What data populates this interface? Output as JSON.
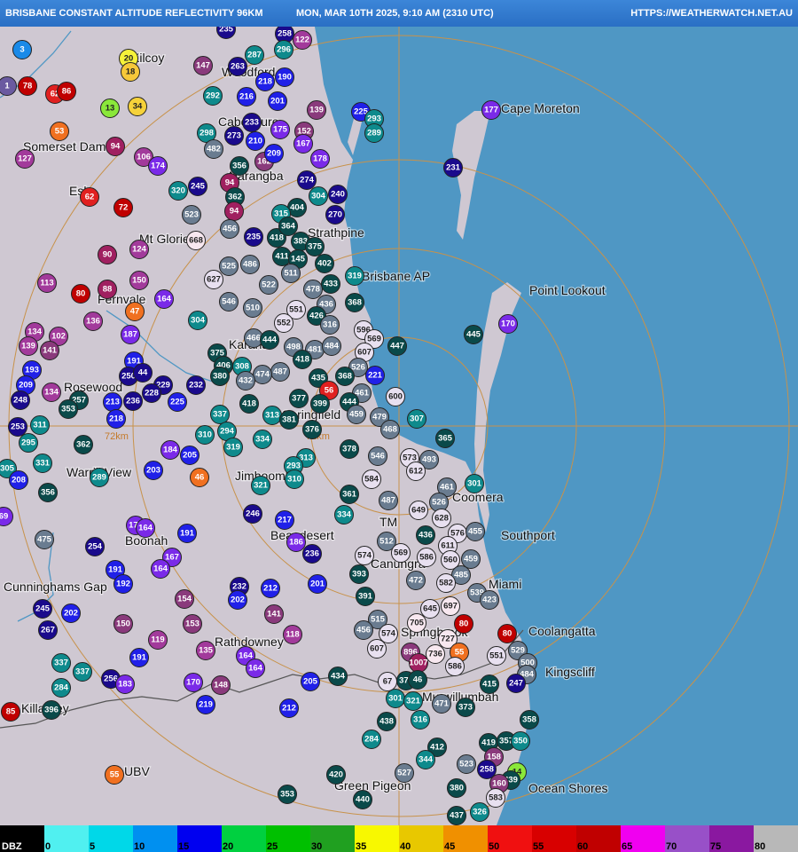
{
  "header": {
    "title": "BRISBANE CONSTANT ALTITUDE REFLECTIVITY 96KM",
    "timestamp": "MON, MAR 10TH 2025, 9:10 AM (2310 UTC)",
    "url": "HTTPS://WEATHERWATCH.NET.AU"
  },
  "map": {
    "range_label": "72km",
    "range_label2": "72km",
    "towns": [
      {
        "name": "Kilcoy"
      },
      {
        "name": "Woodford"
      },
      {
        "name": "Caboolture"
      },
      {
        "name": "Somerset Dam"
      },
      {
        "name": "Esk"
      },
      {
        "name": "Narangba"
      },
      {
        "name": "Mt Glorie"
      },
      {
        "name": "Strathpine"
      },
      {
        "name": "Brisbane AP"
      },
      {
        "name": "Cape Moreton"
      },
      {
        "name": "Point Lookout"
      },
      {
        "name": "Fernvale"
      },
      {
        "name": "Karana"
      },
      {
        "name": "Rosewood"
      },
      {
        "name": "Springfield"
      },
      {
        "name": "Warrill View"
      },
      {
        "name": "Jimboomba"
      },
      {
        "name": "Coomera"
      },
      {
        "name": "TM"
      },
      {
        "name": "Boonah"
      },
      {
        "name": "Beaudesert"
      },
      {
        "name": "Southport"
      },
      {
        "name": "Canungra"
      },
      {
        "name": "Cunninghams Gap"
      },
      {
        "name": "Miami"
      },
      {
        "name": "Coolangatta"
      },
      {
        "name": "Rathdowney"
      },
      {
        "name": "Kingscliff"
      },
      {
        "name": "Killarney"
      },
      {
        "name": "Murwillumbah"
      },
      {
        "name": "UBV"
      },
      {
        "name": "Green Pigeon"
      },
      {
        "name": "Ocean Shores"
      },
      {
        "name": "Springbrook"
      }
    ]
  },
  "markers": [
    {
      "v": "235",
      "c": "#1a0a8c"
    },
    {
      "v": "258",
      "c": "#1a0a8c"
    },
    {
      "v": "122",
      "c": "#a23a9b"
    },
    {
      "v": "20",
      "c": "#f6f23a"
    },
    {
      "v": "18",
      "c": "#f6c83a"
    },
    {
      "v": "287",
      "c": "#0e8a8c"
    },
    {
      "v": "296",
      "c": "#0e8a8c"
    },
    {
      "v": "147",
      "c": "#8a3a7c"
    },
    {
      "v": "263",
      "c": "#1a0a8c"
    },
    {
      "v": "218",
      "c": "#2020e8"
    },
    {
      "v": "190",
      "c": "#2020e8"
    },
    {
      "v": "3",
      "c": "#1a8ae8"
    },
    {
      "v": "1",
      "c": "#6a5aa0"
    },
    {
      "v": "78",
      "c": "#c00000"
    },
    {
      "v": "62",
      "c": "#e02020"
    },
    {
      "v": "86",
      "c": "#c00000"
    },
    {
      "v": "13",
      "c": "#8ae83a"
    },
    {
      "v": "34",
      "c": "#f6d23a"
    },
    {
      "v": "292",
      "c": "#0e8a8c"
    },
    {
      "v": "216",
      "c": "#2020e8"
    },
    {
      "v": "201",
      "c": "#2020e8"
    },
    {
      "v": "139",
      "c": "#8a3a7c"
    },
    {
      "v": "225",
      "c": "#2020e8"
    },
    {
      "v": "293",
      "c": "#0e8a8c"
    },
    {
      "v": "177",
      "c": "#7a2ae8"
    },
    {
      "v": "53",
      "c": "#f07020"
    },
    {
      "v": "298",
      "c": "#0e8a8c"
    },
    {
      "v": "273",
      "c": "#1a0a8c"
    },
    {
      "v": "233",
      "c": "#1a0a8c"
    },
    {
      "v": "175",
      "c": "#7a2ae8"
    },
    {
      "v": "152",
      "c": "#8a3a7c"
    },
    {
      "v": "289",
      "c": "#0e8a8c"
    },
    {
      "v": "127",
      "c": "#a23a9b"
    },
    {
      "v": "94",
      "c": "#a02060"
    },
    {
      "v": "482",
      "c": "#6a7c90"
    },
    {
      "v": "210",
      "c": "#2020e8"
    },
    {
      "v": "167",
      "c": "#7a2ae8"
    },
    {
      "v": "106",
      "c": "#a23a9b"
    },
    {
      "v": "174",
      "c": "#7a2ae8"
    },
    {
      "v": "356",
      "c": "#0a4a4a"
    },
    {
      "v": "162",
      "c": "#8a3a7c"
    },
    {
      "v": "209",
      "c": "#2020e8"
    },
    {
      "v": "178",
      "c": "#7a2ae8"
    },
    {
      "v": "231",
      "c": "#1a0a8c"
    },
    {
      "v": "62",
      "c": "#e02020"
    },
    {
      "v": "320",
      "c": "#0e8a8c"
    },
    {
      "v": "245",
      "c": "#1a0a8c"
    },
    {
      "v": "94",
      "c": "#a02060"
    },
    {
      "v": "274",
      "c": "#1a0a8c"
    },
    {
      "v": "362",
      "c": "#0a4a4a"
    },
    {
      "v": "304",
      "c": "#0e8a8c"
    },
    {
      "v": "240",
      "c": "#1a0a8c"
    },
    {
      "v": "72",
      "c": "#c00000"
    },
    {
      "v": "523",
      "c": "#6a7c90"
    },
    {
      "v": "94",
      "c": "#a02060"
    },
    {
      "v": "404",
      "c": "#0a4a4a"
    },
    {
      "v": "315",
      "c": "#0e8a8c"
    },
    {
      "v": "270",
      "c": "#1a0a8c"
    },
    {
      "v": "456",
      "c": "#6a7c90"
    },
    {
      "v": "235",
      "c": "#1a0a8c"
    },
    {
      "v": "418",
      "c": "#0a4a4a"
    },
    {
      "v": "364",
      "c": "#0a4a4a"
    },
    {
      "v": "383",
      "c": "#0a4a4a"
    },
    {
      "v": "668",
      "c": "#f8e8f0"
    },
    {
      "v": "124",
      "c": "#a23a9b"
    },
    {
      "v": "375",
      "c": "#0a4a4a"
    },
    {
      "v": "90",
      "c": "#a02060"
    },
    {
      "v": "486",
      "c": "#6a7c90"
    },
    {
      "v": "525",
      "c": "#6a7c90"
    },
    {
      "v": "411",
      "c": "#0a4a4a"
    },
    {
      "v": "145",
      "c": "#0a4a4a"
    },
    {
      "v": "402",
      "c": "#0a4a4a"
    },
    {
      "v": "113",
      "c": "#a23a9b"
    },
    {
      "v": "150",
      "c": "#a23a9b"
    },
    {
      "v": "627",
      "c": "#e8e0f0"
    },
    {
      "v": "522",
      "c": "#6a7c90"
    },
    {
      "v": "511",
      "c": "#6a7c90"
    },
    {
      "v": "478",
      "c": "#6a7c90"
    },
    {
      "v": "433",
      "c": "#0a4a4a"
    },
    {
      "v": "319",
      "c": "#0e8a8c"
    },
    {
      "v": "80",
      "c": "#c00000"
    },
    {
      "v": "88",
      "c": "#a02060"
    },
    {
      "v": "164",
      "c": "#7a2ae8"
    },
    {
      "v": "546",
      "c": "#6a7c90"
    },
    {
      "v": "510",
      "c": "#6a7c90"
    },
    {
      "v": "551",
      "c": "#e8e0f0"
    },
    {
      "v": "436",
      "c": "#6a7c90"
    },
    {
      "v": "368",
      "c": "#0a4a4a"
    },
    {
      "v": "47",
      "c": "#f07020"
    },
    {
      "v": "304",
      "c": "#0e8a8c"
    },
    {
      "v": "552",
      "c": "#e8e0f0"
    },
    {
      "v": "426",
      "c": "#0a4a4a"
    },
    {
      "v": "316",
      "c": "#6a7c90"
    },
    {
      "v": "596",
      "c": "#e8e0f0"
    },
    {
      "v": "136",
      "c": "#a23a9b"
    },
    {
      "v": "187",
      "c": "#7a2ae8"
    },
    {
      "v": "466",
      "c": "#6a7c90"
    },
    {
      "v": "444",
      "c": "#0a4a4a"
    },
    {
      "v": "569",
      "c": "#e8e0f0"
    },
    {
      "v": "447",
      "c": "#0a4a4a"
    },
    {
      "v": "445",
      "c": "#0a4a4a"
    },
    {
      "v": "170",
      "c": "#7a2ae8"
    },
    {
      "v": "134",
      "c": "#a23a9b"
    },
    {
      "v": "102",
      "c": "#a23a9b"
    },
    {
      "v": "139",
      "c": "#a23a9b"
    },
    {
      "v": "141",
      "c": "#8a3a7c"
    },
    {
      "v": "375",
      "c": "#0a4a4a"
    },
    {
      "v": "498",
      "c": "#6a7c90"
    },
    {
      "v": "481",
      "c": "#6a7c90"
    },
    {
      "v": "484",
      "c": "#6a7c90"
    },
    {
      "v": "607",
      "c": "#e8e0f0"
    },
    {
      "v": "193",
      "c": "#2020e8"
    },
    {
      "v": "191",
      "c": "#2020e8"
    },
    {
      "v": "406",
      "c": "#0a4a4a"
    },
    {
      "v": "308",
      "c": "#0e8a8c"
    },
    {
      "v": "487",
      "c": "#6a7c90"
    },
    {
      "v": "418",
      "c": "#0a4a4a"
    },
    {
      "v": "526",
      "c": "#6a7c90"
    },
    {
      "v": "221",
      "c": "#2020e8"
    },
    {
      "v": "209",
      "c": "#2020e8"
    },
    {
      "v": "250",
      "c": "#1a0a8c"
    },
    {
      "v": "44",
      "c": "#1a0a8c"
    },
    {
      "v": "134",
      "c": "#a23a9b"
    },
    {
      "v": "229",
      "c": "#1a0a8c"
    },
    {
      "v": "232",
      "c": "#1a0a8c"
    },
    {
      "v": "380",
      "c": "#0a4a4a"
    },
    {
      "v": "474",
      "c": "#6a7c90"
    },
    {
      "v": "435",
      "c": "#0a4a4a"
    },
    {
      "v": "368",
      "c": "#0a4a4a"
    },
    {
      "v": "600",
      "c": "#e8e0f0"
    },
    {
      "v": "248",
      "c": "#1a0a8c"
    },
    {
      "v": "236",
      "c": "#1a0a8c"
    },
    {
      "v": "228",
      "c": "#1a0a8c"
    },
    {
      "v": "432",
      "c": "#6a7c90"
    },
    {
      "v": "377",
      "c": "#0a4a4a"
    },
    {
      "v": "56",
      "c": "#e02020"
    },
    {
      "v": "461",
      "c": "#6a7c90"
    },
    {
      "v": "257",
      "c": "#0a4a4a"
    },
    {
      "v": "213",
      "c": "#2020e8"
    },
    {
      "v": "225",
      "c": "#2020e8"
    },
    {
      "v": "418",
      "c": "#0a4a4a"
    },
    {
      "v": "399",
      "c": "#0a4a4a"
    },
    {
      "v": "444",
      "c": "#0a4a4a"
    },
    {
      "v": "353",
      "c": "#0a4a4a"
    },
    {
      "v": "337",
      "c": "#0e8a8c"
    },
    {
      "v": "313",
      "c": "#0e8a8c"
    },
    {
      "v": "381",
      "c": "#0a4a4a"
    },
    {
      "v": "459",
      "c": "#6a7c90"
    },
    {
      "v": "479",
      "c": "#6a7c90"
    },
    {
      "v": "307",
      "c": "#0e8a8c"
    },
    {
      "v": "253",
      "c": "#1a0a8c"
    },
    {
      "v": "311",
      "c": "#0e8a8c"
    },
    {
      "v": "218",
      "c": "#2020e8"
    },
    {
      "v": "294",
      "c": "#0e8a8c"
    },
    {
      "v": "376",
      "c": "#0a4a4a"
    },
    {
      "v": "468",
      "c": "#6a7c90"
    },
    {
      "v": "295",
      "c": "#0e8a8c"
    },
    {
      "v": "362",
      "c": "#0a4a4a"
    },
    {
      "v": "184",
      "c": "#7a2ae8"
    },
    {
      "v": "310",
      "c": "#0e8a8c"
    },
    {
      "v": "334",
      "c": "#0e8a8c"
    },
    {
      "v": "365",
      "c": "#0a4a4a"
    },
    {
      "v": "319",
      "c": "#0e8a8c"
    },
    {
      "v": "378",
      "c": "#0a4a4a"
    },
    {
      "v": "205",
      "c": "#2020e8"
    },
    {
      "v": "313",
      "c": "#0e8a8c"
    },
    {
      "v": "546",
      "c": "#6a7c90"
    },
    {
      "v": "573",
      "c": "#e8e0f0"
    },
    {
      "v": "493",
      "c": "#6a7c90"
    },
    {
      "v": "331",
      "c": "#0e8a8c"
    },
    {
      "v": "305",
      "c": "#0e8a8c"
    },
    {
      "v": "203",
      "c": "#2020e8"
    },
    {
      "v": "289",
      "c": "#0e8a8c"
    },
    {
      "v": "46",
      "c": "#f07020"
    },
    {
      "v": "293",
      "c": "#0e8a8c"
    },
    {
      "v": "612",
      "c": "#e8e0f0"
    },
    {
      "v": "208",
      "c": "#2020e8"
    },
    {
      "v": "321",
      "c": "#0e8a8c"
    },
    {
      "v": "310",
      "c": "#0e8a8c"
    },
    {
      "v": "584",
      "c": "#e8e0f0"
    },
    {
      "v": "461",
      "c": "#6a7c90"
    },
    {
      "v": "301",
      "c": "#0e8a8c"
    },
    {
      "v": "356",
      "c": "#0a4a4a"
    },
    {
      "v": "361",
      "c": "#0a4a4a"
    },
    {
      "v": "487",
      "c": "#6a7c90"
    },
    {
      "v": "526",
      "c": "#6a7c90"
    },
    {
      "v": "649",
      "c": "#e8e0f0"
    },
    {
      "v": "246",
      "c": "#1a0a8c"
    },
    {
      "v": "334",
      "c": "#0e8a8c"
    },
    {
      "v": "628",
      "c": "#e8e0f0"
    },
    {
      "v": "69",
      "c": "#7a2ae8"
    },
    {
      "v": "217",
      "c": "#2020e8"
    },
    {
      "v": "170",
      "c": "#7a2ae8"
    },
    {
      "v": "164",
      "c": "#7a2ae8"
    },
    {
      "v": "475",
      "c": "#6a7c90"
    },
    {
      "v": "436",
      "c": "#0a4a4a"
    },
    {
      "v": "576",
      "c": "#e8e0f0"
    },
    {
      "v": "455",
      "c": "#6a7c90"
    },
    {
      "v": "191",
      "c": "#2020e8"
    },
    {
      "v": "254",
      "c": "#1a0a8c"
    },
    {
      "v": "186",
      "c": "#7a2ae8"
    },
    {
      "v": "512",
      "c": "#6a7c90"
    },
    {
      "v": "611",
      "c": "#e8e0f0"
    },
    {
      "v": "167",
      "c": "#7a2ae8"
    },
    {
      "v": "236",
      "c": "#1a0a8c"
    },
    {
      "v": "574",
      "c": "#e8e0f0"
    },
    {
      "v": "569",
      "c": "#e8e0f0"
    },
    {
      "v": "586",
      "c": "#e8e0f0"
    },
    {
      "v": "560",
      "c": "#e8e0f0"
    },
    {
      "v": "459",
      "c": "#6a7c90"
    },
    {
      "v": "164",
      "c": "#7a2ae8"
    },
    {
      "v": "191",
      "c": "#2020e8"
    },
    {
      "v": "393",
      "c": "#0a4a4a"
    },
    {
      "v": "485",
      "c": "#6a7c90"
    },
    {
      "v": "192",
      "c": "#2020e8"
    },
    {
      "v": "201",
      "c": "#2020e8"
    },
    {
      "v": "472",
      "c": "#6a7c90"
    },
    {
      "v": "582",
      "c": "#e8e0f0"
    },
    {
      "v": "539",
      "c": "#6a7c90"
    },
    {
      "v": "232",
      "c": "#1a0a8c"
    },
    {
      "v": "212",
      "c": "#2020e8"
    },
    {
      "v": "391",
      "c": "#0a4a4a"
    },
    {
      "v": "645",
      "c": "#e8e0f0"
    },
    {
      "v": "697",
      "c": "#f8e8f0"
    },
    {
      "v": "423",
      "c": "#6a7c90"
    },
    {
      "v": "154",
      "c": "#8a3a7c"
    },
    {
      "v": "202",
      "c": "#2020e8"
    },
    {
      "v": "245",
      "c": "#1a0a8c"
    },
    {
      "v": "202",
      "c": "#2020e8"
    },
    {
      "v": "141",
      "c": "#8a3a7c"
    },
    {
      "v": "515",
      "c": "#6a7c90"
    },
    {
      "v": "705",
      "c": "#f8e8f0"
    },
    {
      "v": "80",
      "c": "#c00000"
    },
    {
      "v": "267",
      "c": "#1a0a8c"
    },
    {
      "v": "150",
      "c": "#8a3a7c"
    },
    {
      "v": "153",
      "c": "#8a3a7c"
    },
    {
      "v": "118",
      "c": "#a23a9b"
    },
    {
      "v": "456",
      "c": "#6a7c90"
    },
    {
      "v": "574",
      "c": "#e8e0f0"
    },
    {
      "v": "727",
      "c": "#f8e8f0"
    },
    {
      "v": "80",
      "c": "#c00000"
    },
    {
      "v": "119",
      "c": "#a23a9b"
    },
    {
      "v": "607",
      "c": "#e8e0f0"
    },
    {
      "v": "896",
      "c": "#8a3a7c"
    },
    {
      "v": "736",
      "c": "#f8e8f0"
    },
    {
      "v": "55",
      "c": "#f07020"
    },
    {
      "v": "529",
      "c": "#6a7c90"
    },
    {
      "v": "135",
      "c": "#a23a9b"
    },
    {
      "v": "164",
      "c": "#7a2ae8"
    },
    {
      "v": "1007",
      "c": "#a02060"
    },
    {
      "v": "586",
      "c": "#e8e0f0"
    },
    {
      "v": "551",
      "c": "#e8e0f0"
    },
    {
      "v": "500",
      "c": "#6a7c90"
    },
    {
      "v": "337",
      "c": "#0e8a8c"
    },
    {
      "v": "191",
      "c": "#2020e8"
    },
    {
      "v": "164",
      "c": "#7a2ae8"
    },
    {
      "v": "337",
      "c": "#0e8a8c"
    },
    {
      "v": "484",
      "c": "#6a7c90"
    },
    {
      "v": "256",
      "c": "#1a0a8c"
    },
    {
      "v": "183",
      "c": "#7a2ae8"
    },
    {
      "v": "170",
      "c": "#7a2ae8"
    },
    {
      "v": "148",
      "c": "#8a3a7c"
    },
    {
      "v": "205",
      "c": "#2020e8"
    },
    {
      "v": "434",
      "c": "#0a4a4a"
    },
    {
      "v": "67",
      "c": "#e8e0f0"
    },
    {
      "v": "377",
      "c": "#0a4a4a"
    },
    {
      "v": "46",
      "c": "#0a4a4a"
    },
    {
      "v": "415",
      "c": "#0a4a4a"
    },
    {
      "v": "247",
      "c": "#1a0a8c"
    },
    {
      "v": "284",
      "c": "#0e8a8c"
    },
    {
      "v": "219",
      "c": "#2020e8"
    },
    {
      "v": "301",
      "c": "#0e8a8c"
    },
    {
      "v": "321",
      "c": "#0e8a8c"
    },
    {
      "v": "471",
      "c": "#6a7c90"
    },
    {
      "v": "373",
      "c": "#0a4a4a"
    },
    {
      "v": "85",
      "c": "#c00000"
    },
    {
      "v": "396",
      "c": "#0a4a4a"
    },
    {
      "v": "212",
      "c": "#2020e8"
    },
    {
      "v": "438",
      "c": "#0a4a4a"
    },
    {
      "v": "316",
      "c": "#0e8a8c"
    },
    {
      "v": "358",
      "c": "#0a4a4a"
    },
    {
      "v": "284",
      "c": "#0e8a8c"
    },
    {
      "v": "412",
      "c": "#0a4a4a"
    },
    {
      "v": "419",
      "c": "#0a4a4a"
    },
    {
      "v": "357",
      "c": "#0a4a4a"
    },
    {
      "v": "350",
      "c": "#0e8a8c"
    },
    {
      "v": "344",
      "c": "#0e8a8c"
    },
    {
      "v": "158",
      "c": "#8a3a7c"
    },
    {
      "v": "55",
      "c": "#f07020"
    },
    {
      "v": "527",
      "c": "#6a7c90"
    },
    {
      "v": "523",
      "c": "#6a7c90"
    },
    {
      "v": "258",
      "c": "#1a0a8c"
    },
    {
      "v": "14",
      "c": "#8ae83a"
    },
    {
      "v": "439",
      "c": "#0a4a4a"
    },
    {
      "v": "420",
      "c": "#0a4a4a"
    },
    {
      "v": "380",
      "c": "#0a4a4a"
    },
    {
      "v": "160",
      "c": "#8a3a7c"
    },
    {
      "v": "353",
      "c": "#0a4a4a"
    },
    {
      "v": "440",
      "c": "#0a4a4a"
    },
    {
      "v": "583",
      "c": "#e8e0f0"
    },
    {
      "v": "437",
      "c": "#0a4a4a"
    },
    {
      "v": "326",
      "c": "#0e8a8c"
    }
  ],
  "legend": {
    "unit": "DBZ",
    "stops": [
      {
        "label": "0",
        "color": "#50f0f0"
      },
      {
        "label": "5",
        "color": "#00d8e8"
      },
      {
        "label": "10",
        "color": "#0090f0"
      },
      {
        "label": "15",
        "color": "#0000f0"
      },
      {
        "label": "20",
        "color": "#00d040"
      },
      {
        "label": "25",
        "color": "#00c000"
      },
      {
        "label": "30",
        "color": "#20a020"
      },
      {
        "label": "35",
        "color": "#f8f800"
      },
      {
        "label": "40",
        "color": "#e8c800"
      },
      {
        "label": "45",
        "color": "#f09000"
      },
      {
        "label": "50",
        "color": "#f01010"
      },
      {
        "label": "55",
        "color": "#d80000"
      },
      {
        "label": "60",
        "color": "#c00000"
      },
      {
        "label": "65",
        "color": "#f000f0"
      },
      {
        "label": "70",
        "color": "#9850c8"
      },
      {
        "label": "75",
        "color": "#8a18a0"
      },
      {
        "label": "80",
        "color": "#b8b8b8"
      }
    ]
  }
}
